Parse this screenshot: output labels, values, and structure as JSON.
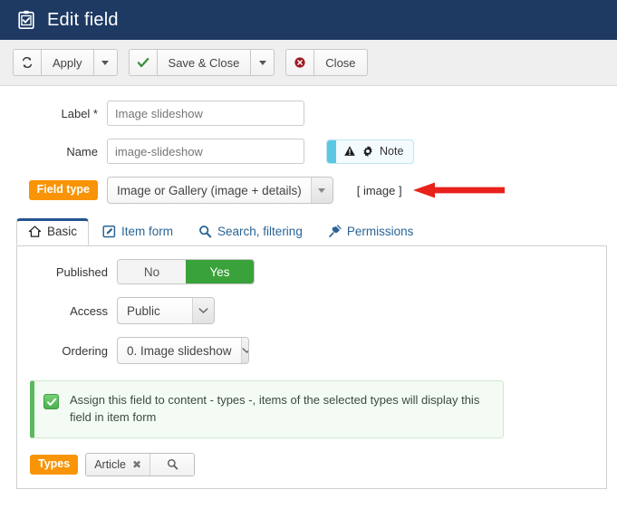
{
  "header": {
    "title": "Edit field",
    "icon": "clipboard-check-icon",
    "bg_color": "#1e3a63"
  },
  "toolbar": {
    "apply_label": "Apply",
    "apply_icon": "refresh-icon",
    "apply_caret": "caret-down-icon",
    "save_close_label": "Save & Close",
    "save_close_icon": "check-icon",
    "save_close_caret": "caret-down-icon",
    "close_label": "Close",
    "close_icon": "cancel-circle-icon"
  },
  "form": {
    "label_field": {
      "label": "Label *",
      "value": "Image slideshow",
      "placeholder": "Image slideshow"
    },
    "name_field": {
      "label": "Name",
      "value": "image-slideshow",
      "placeholder": "image-slideshow"
    },
    "note_badge": {
      "label": "Note",
      "warning_icon": "warning-triangle-icon",
      "gear_icon": "gear-icon",
      "accent_color": "#5bc8e3"
    },
    "field_type": {
      "label": "Field type",
      "label_color": "#f89406",
      "selected": "Image or Gallery (image + details)",
      "caret": "caret-down-icon"
    },
    "image_note": "[ image ]",
    "annotation": {
      "type": "arrow-left",
      "color": "#e8211a"
    }
  },
  "tabs": [
    {
      "label": "Basic",
      "icon": "home-icon",
      "active": true
    },
    {
      "label": "Item form",
      "icon": "pencil-square-icon",
      "active": false
    },
    {
      "label": "Search, filtering",
      "icon": "magnifier-icon",
      "active": false
    },
    {
      "label": "Permissions",
      "icon": "plug-icon",
      "active": false
    }
  ],
  "panel": {
    "published": {
      "label": "Published",
      "option_no": "No",
      "option_yes": "Yes",
      "selected": "Yes",
      "on_color": "#3aa23a"
    },
    "access": {
      "label": "Access",
      "selected": "Public",
      "caret": "chevron-down-icon"
    },
    "ordering": {
      "label": "Ordering",
      "selected": "0. Image slideshow",
      "caret": "chevron-down-icon"
    },
    "notice": {
      "text": "Assign this field to content - types -, items of the selected types will display this field in item form",
      "checked": true,
      "accent_color": "#5cb85c"
    },
    "types": {
      "label": "Types",
      "label_color": "#f89406",
      "chips": [
        {
          "label": "Article",
          "remove_icon": "close-x-icon"
        }
      ],
      "search_icon": "magnifier-icon"
    }
  }
}
